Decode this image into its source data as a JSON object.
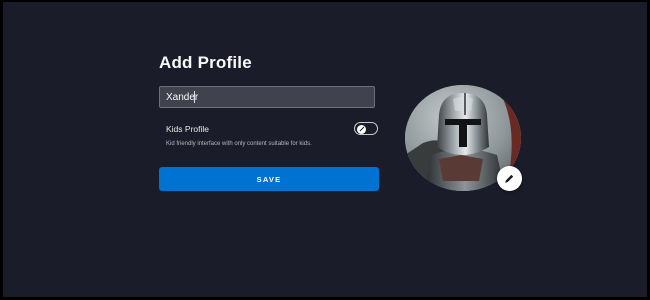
{
  "page": {
    "title": "Add Profile"
  },
  "profile_form": {
    "name_value": "Xander",
    "kids_profile_label": "Kids Profile",
    "kids_profile_description": "Kid friendly interface with only content suitable for kids.",
    "kids_profile_enabled": false,
    "save_label": "SAVE"
  },
  "avatar": {
    "image": "helmeted-armored-character-avatar",
    "edit_icon": "pencil-icon"
  },
  "colors": {
    "background": "#1a1d29",
    "input_background": "#40424e",
    "accent_blue": "#0072d2",
    "text": "#f9f9f9"
  }
}
